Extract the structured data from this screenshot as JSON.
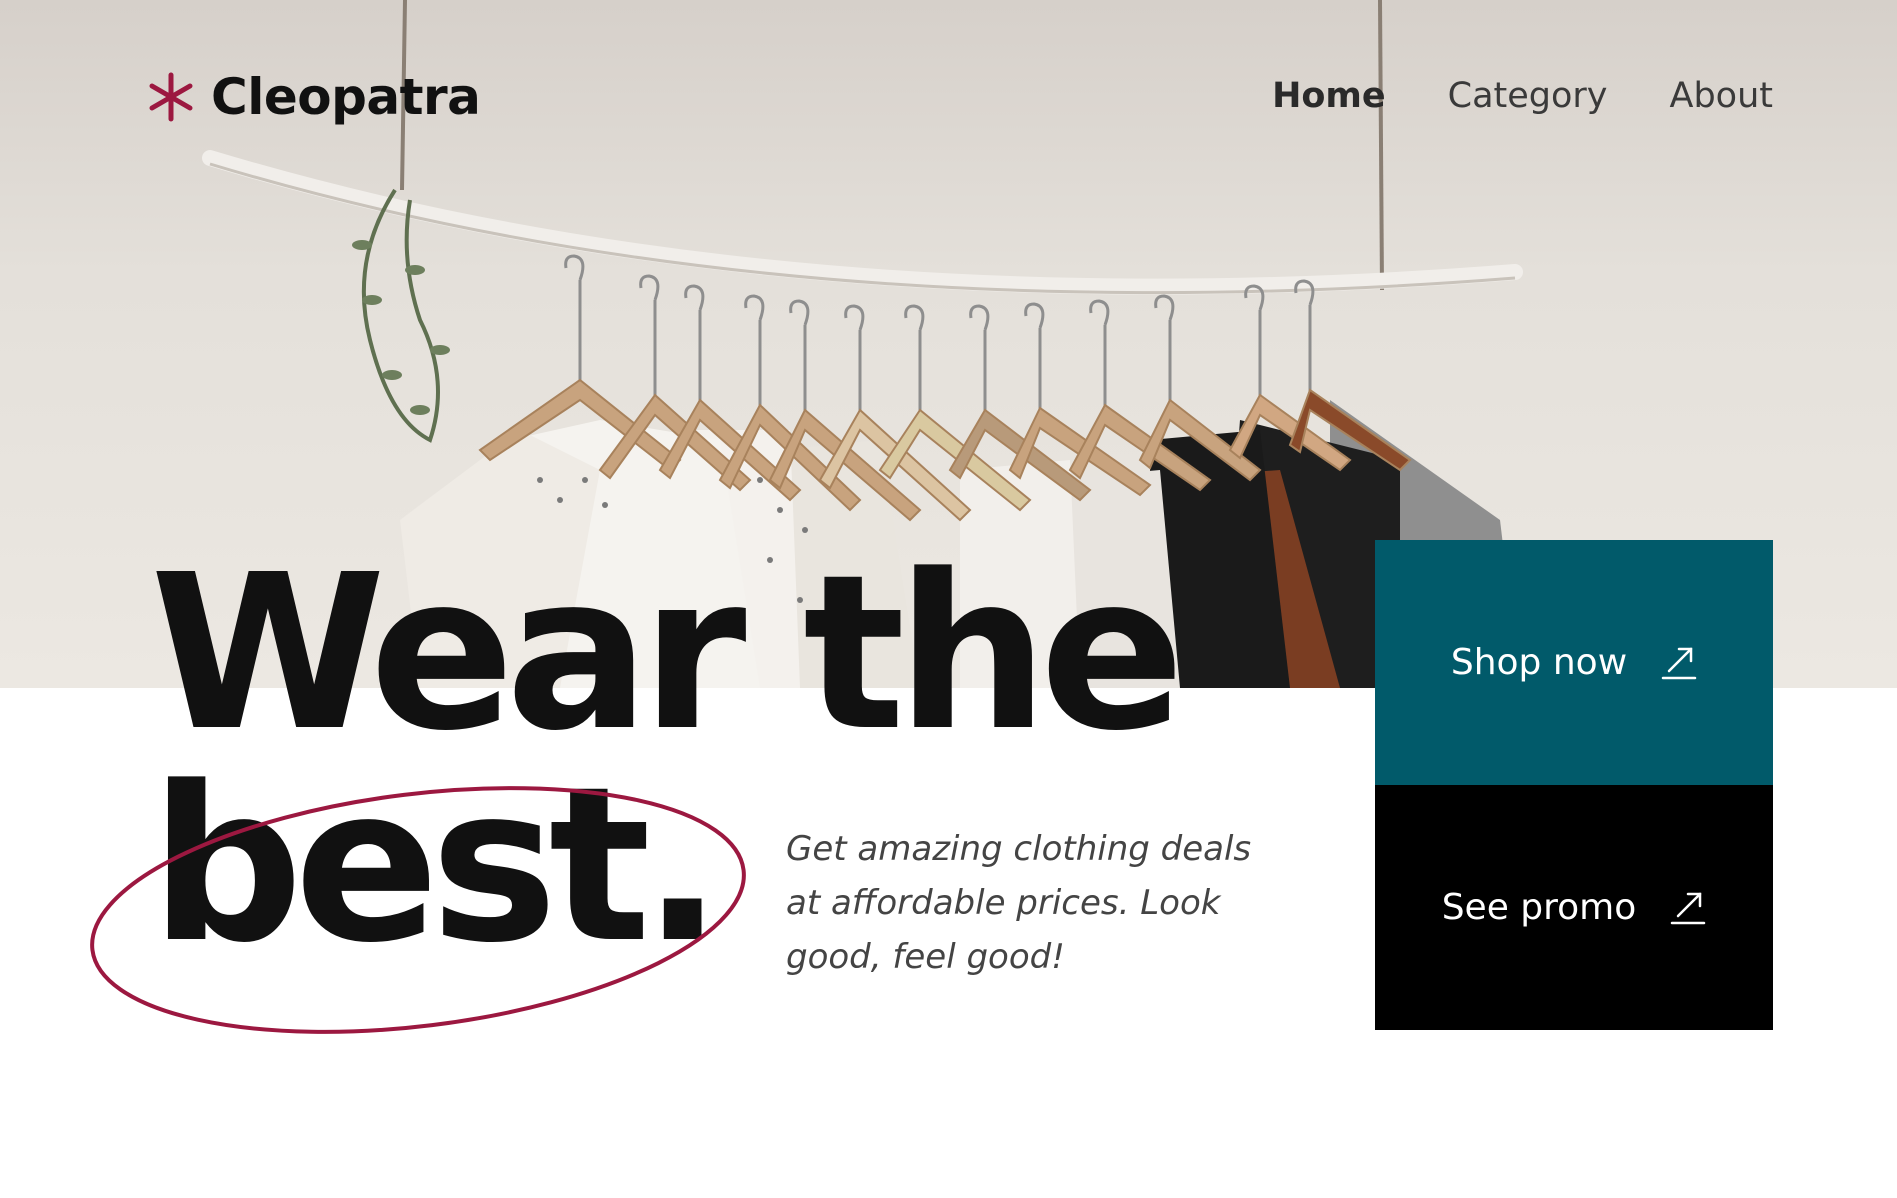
{
  "brand": {
    "name": "Cleopatra",
    "logo_icon": "asterisk-icon",
    "accent_color": "#9c1840"
  },
  "nav": {
    "items": [
      {
        "label": "Home",
        "active": true
      },
      {
        "label": "Category",
        "active": false
      },
      {
        "label": "About",
        "active": false
      }
    ]
  },
  "hero": {
    "image": "clothes-rack-photo",
    "headline_line1": "Wear the",
    "headline_line2": "best.",
    "tagline": "Get amazing clothing deals at affordable prices. Look good, feel good!"
  },
  "cta": {
    "shop_label": "Shop now",
    "shop_color": "#015a6a",
    "promo_label": "See promo",
    "promo_color": "#000000",
    "arrow_icon": "arrow-up-right-icon"
  }
}
